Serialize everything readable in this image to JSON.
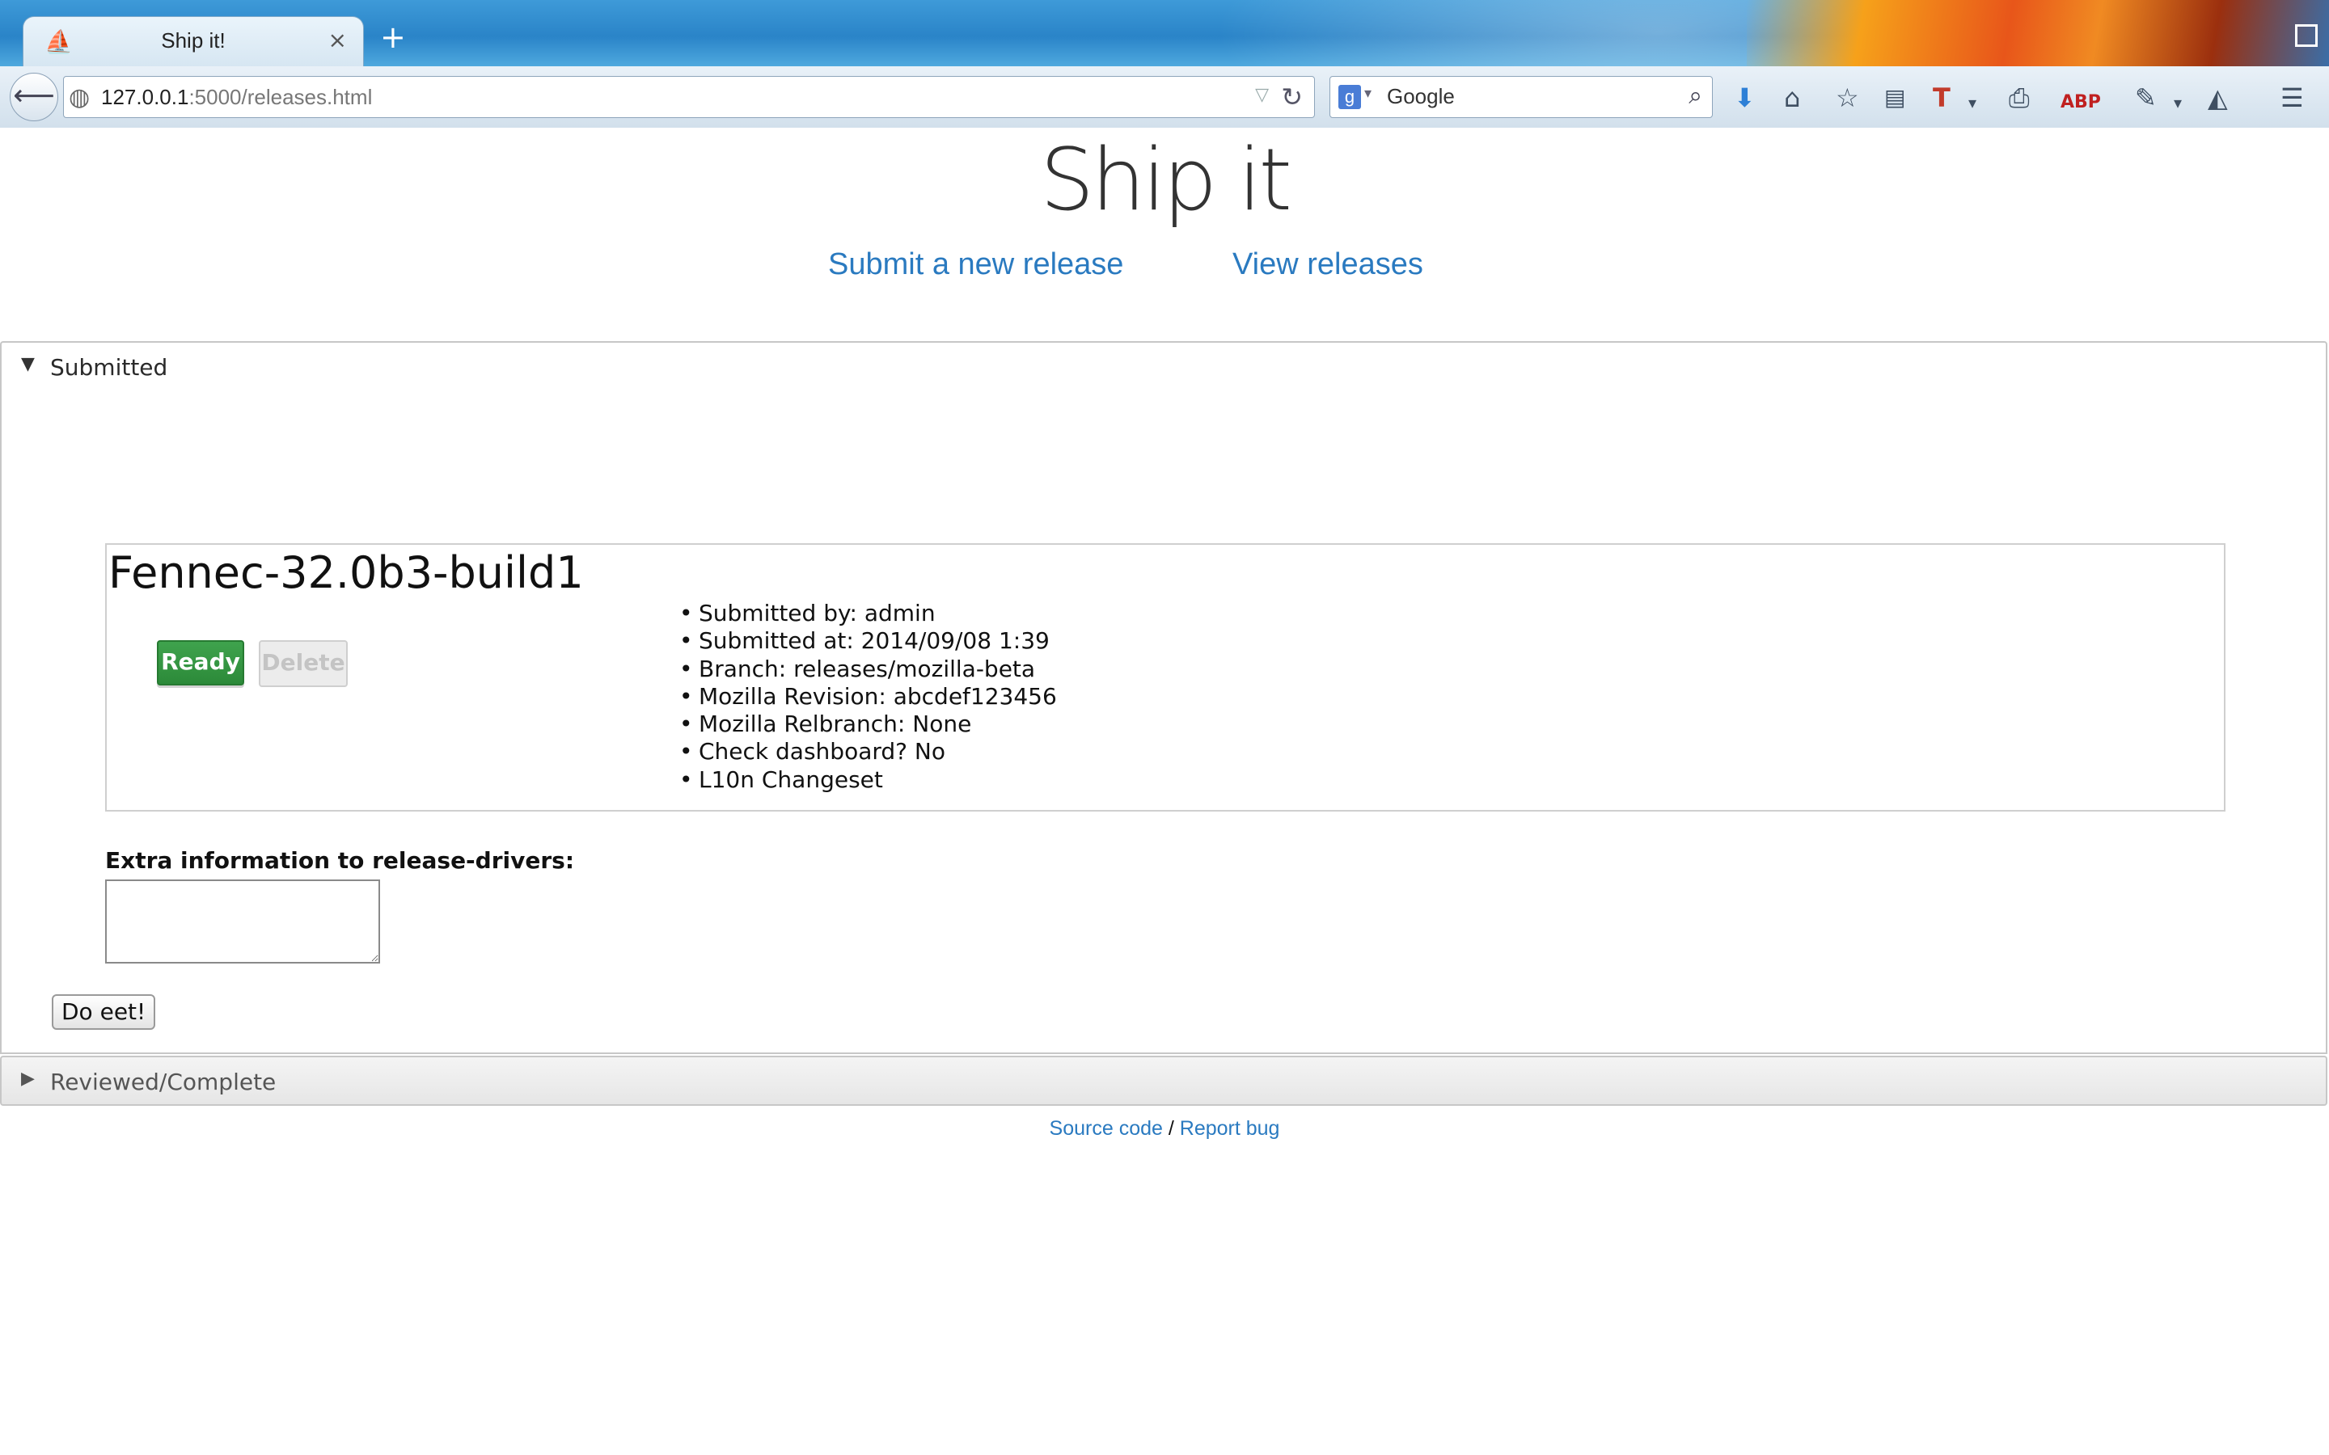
{
  "browser": {
    "tab_title": "Ship it!",
    "new_tab_icon": "+",
    "close_icon": "×",
    "url_host": "127.0.0.1",
    "url_rest": ":5000/releases.html",
    "search_engine_letter": "g",
    "search_placeholder": "Google",
    "toolbar_icons": [
      "download-icon",
      "home-icon",
      "bookmark-star-icon",
      "reading-list-icon",
      "text-plugin-icon",
      "print-icon",
      "adblock-icon",
      "tools-icon",
      "pocket-icon",
      "menu-icon"
    ]
  },
  "header": {
    "title": "Ship it",
    "nav": {
      "submit_label": "Submit a new release",
      "view_label": "View releases"
    }
  },
  "sections": {
    "submitted": {
      "label": "Submitted",
      "release": {
        "name": "Fennec-32.0b3-build1",
        "ready_label": "Ready",
        "delete_label": "Delete",
        "details": [
          "Submitted by: admin",
          "Submitted at: 2014/09/08 1:39",
          "Branch: releases/mozilla-beta",
          "Mozilla Revision: abcdef123456",
          "Mozilla Relbranch: None",
          "Check dashboard? No",
          "L10n Changeset"
        ]
      },
      "extra_label": "Extra information to release-drivers:",
      "extra_value": "",
      "submit_label": "Do eet!"
    },
    "reviewed": {
      "label": "Reviewed/Complete"
    }
  },
  "footer": {
    "source_label": "Source code",
    "separator": "/",
    "bug_label": "Report bug"
  },
  "colors": {
    "link": "#2a7ac0",
    "ready_green": "#3a9a46",
    "browser_blue": "#2a84c8"
  }
}
